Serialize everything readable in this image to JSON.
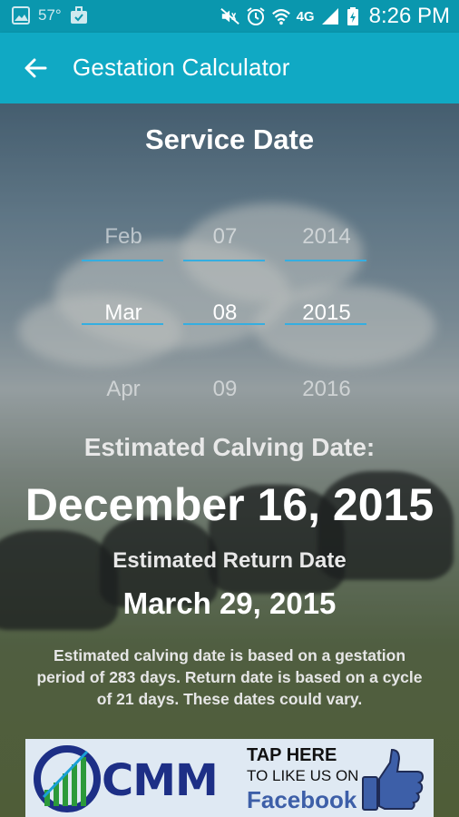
{
  "status_bar": {
    "temperature": "57°",
    "network": "4G",
    "time": "8:26 PM",
    "icons": [
      "gallery-icon",
      "briefcase-icon",
      "mute-icon",
      "alarm-icon",
      "wifi-icon",
      "signal-icon",
      "battery-charging-icon"
    ]
  },
  "app_bar": {
    "title": "Gestation Calculator",
    "back_icon": "arrow-left-icon"
  },
  "service_date": {
    "title": "Service Date",
    "month": {
      "prev": "Feb",
      "selected": "Mar",
      "next": "Apr"
    },
    "day": {
      "prev": "07",
      "selected": "08",
      "next": "09"
    },
    "year": {
      "prev": "2014",
      "selected": "2015",
      "next": "2016"
    }
  },
  "results": {
    "calving_label": "Estimated Calving Date:",
    "calving_date": "December 16, 2015",
    "return_label": "Estimated Return Date",
    "return_date": "March 29, 2015",
    "note": "Estimated calving date is based on a gestation period of 283 days. Return date is based on a cycle of 21 days. These dates could vary."
  },
  "ad": {
    "brand": "CMM",
    "tap_text": "TAP HERE",
    "like_text": "TO LIKE US ON",
    "facebook_text": "Facebook"
  },
  "colors": {
    "status_bar": "#0a97ae",
    "app_bar": "#10a9c4",
    "picker_line": "#35aee0",
    "ad_brand": "#1d2f86",
    "facebook": "#3d5fa8"
  }
}
